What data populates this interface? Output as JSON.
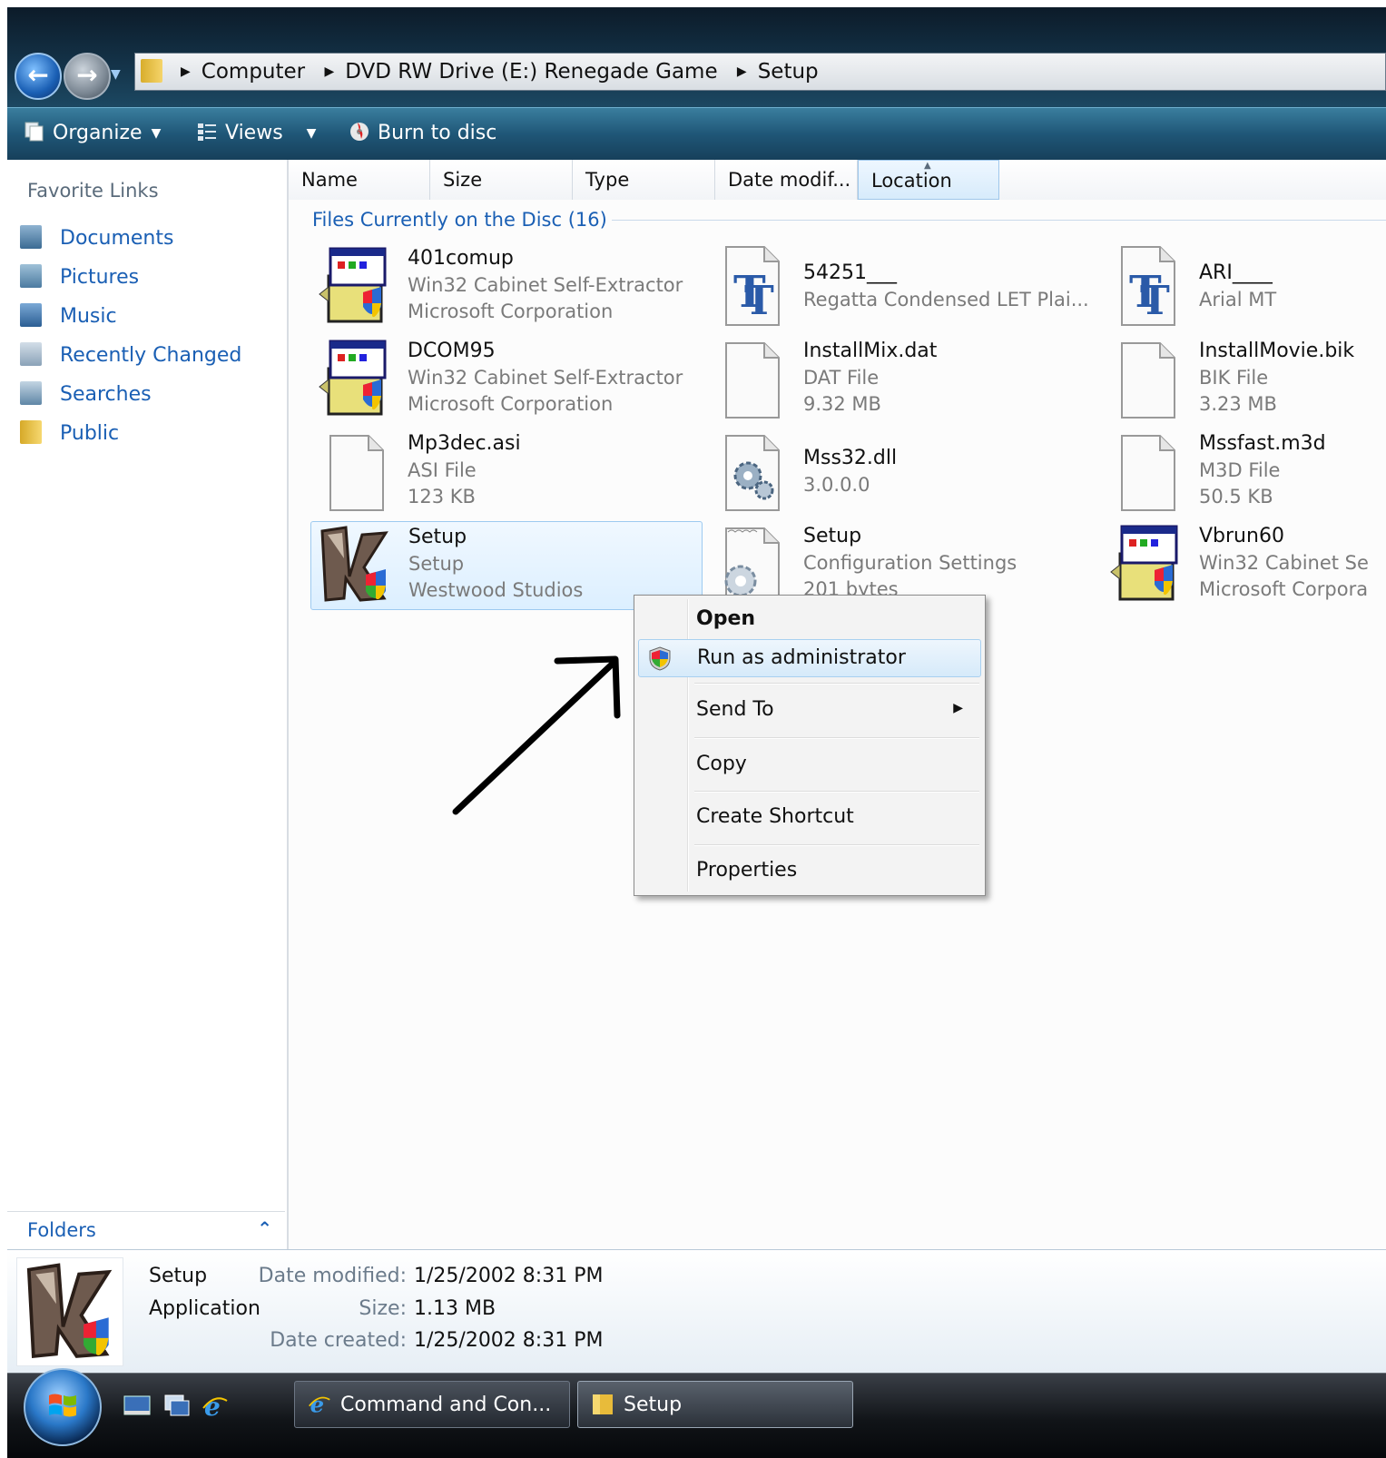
{
  "address": {
    "breadcrumbs": [
      "Computer",
      "DVD RW Drive (E:) Renegade Game",
      "Setup"
    ]
  },
  "toolbar": {
    "organize": "Organize",
    "views": "Views",
    "burn": "Burn to disc"
  },
  "sidebar": {
    "heading": "Favorite Links",
    "links": [
      "Documents",
      "Pictures",
      "Music",
      "Recently Changed",
      "Searches",
      "Public"
    ],
    "folders_label": "Folders"
  },
  "columns": [
    "Name",
    "Size",
    "Type",
    "Date modif...",
    "Location"
  ],
  "group_label": "Files Currently on the Disc (16)",
  "files": [
    {
      "name": "401comup",
      "line1": "Win32 Cabinet Self-Extractor",
      "line2": "Microsoft Corporation",
      "icon": "installer-icon"
    },
    {
      "name": "54251___",
      "line1": "Regatta Condensed LET Plai...",
      "line2": "",
      "icon": "font-icon"
    },
    {
      "name": "ARI____",
      "line1": "Arial MT",
      "line2": "",
      "icon": "font-icon"
    },
    {
      "name": "DCOM95",
      "line1": "Win32 Cabinet Self-Extractor",
      "line2": "Microsoft Corporation",
      "icon": "installer-icon"
    },
    {
      "name": "InstallMix.dat",
      "line1": "DAT File",
      "line2": "9.32 MB",
      "icon": "blank-file-icon"
    },
    {
      "name": "InstallMovie.bik",
      "line1": "BIK File",
      "line2": "3.23 MB",
      "icon": "blank-file-icon"
    },
    {
      "name": "Mp3dec.asi",
      "line1": "ASI File",
      "line2": "123 KB",
      "icon": "blank-file-icon"
    },
    {
      "name": "Mss32.dll",
      "line1": "3.0.0.0",
      "line2": "",
      "icon": "dll-gear-icon"
    },
    {
      "name": "Mssfast.m3d",
      "line1": "M3D File",
      "line2": "50.5 KB",
      "icon": "blank-file-icon"
    },
    {
      "name": "Setup",
      "line1": "Setup",
      "line2": "Westwood Studios",
      "icon": "renegade-app-icon"
    },
    {
      "name": "Setup",
      "line1": "Configuration Settings",
      "line2": "201 bytes",
      "icon": "config-file-icon"
    },
    {
      "name": "Vbrun60",
      "line1": "Win32 Cabinet Se",
      "line2": "Microsoft Corpora",
      "icon": "installer-icon"
    }
  ],
  "context_menu": {
    "items": [
      "Open",
      "Run as administrator",
      "Send To",
      "Copy",
      "Create Shortcut",
      "Properties"
    ]
  },
  "details": {
    "name": "Setup",
    "kind": "Application",
    "date_modified_label": "Date modified:",
    "date_modified": "1/25/2002 8:31 PM",
    "size_label": "Size:",
    "size": "1.13 MB",
    "date_created_label": "Date created:",
    "date_created": "1/25/2002 8:31 PM"
  },
  "taskbar": {
    "tasks": [
      "Command and Con...",
      "Setup"
    ]
  },
  "colors": {
    "link_blue": "#1a5fb4",
    "toolbar": "#1f5677",
    "selection": "#dcefff"
  }
}
